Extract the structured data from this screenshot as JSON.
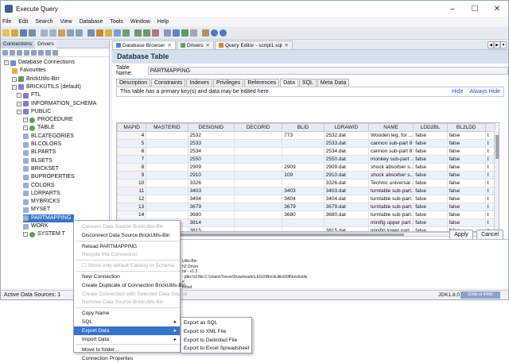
{
  "window": {
    "title": "Execute Query",
    "controls": [
      "–",
      "☐",
      "✕"
    ]
  },
  "menubar": [
    "File",
    "Edit",
    "Search",
    "View",
    "Database",
    "Tools",
    "Window",
    "Help"
  ],
  "left": {
    "tabs": [
      "Connections",
      "Drivers"
    ],
    "tree": [
      {
        "label": "Database Connections",
        "level": 0,
        "icon": "database-icon"
      },
      {
        "label": "Favourites",
        "level": 1,
        "icon": "folder-icon"
      },
      {
        "label": "BrickUtils-Bin",
        "level": 1,
        "icon": "connection-icon"
      },
      {
        "label": "BRICKUTILS (default)",
        "level": 2,
        "icon": "catalog-icon"
      },
      {
        "label": "FTL",
        "level": 3,
        "icon": "schema-icon"
      },
      {
        "label": "INFORMATION_SCHEMA",
        "level": 3,
        "icon": "schema-icon"
      },
      {
        "label": "PUBLIC",
        "level": 3,
        "icon": "schema-icon"
      },
      {
        "label": "PROCEDURE",
        "level": 4,
        "icon": "procedure-icon"
      },
      {
        "label": "TABLE",
        "level": 4,
        "icon": "table-group-icon"
      },
      {
        "label": "BLCATEGORIES",
        "level": 5,
        "icon": "table-icon"
      },
      {
        "label": "BLCOLORS",
        "level": 5,
        "icon": "table-icon"
      },
      {
        "label": "BLPARTS",
        "level": 5,
        "icon": "table-icon"
      },
      {
        "label": "BLSETS",
        "level": 5,
        "icon": "table-icon"
      },
      {
        "label": "BRICKSET",
        "level": 5,
        "icon": "table-icon"
      },
      {
        "label": "BUPROPERTIES",
        "level": 5,
        "icon": "table-icon"
      },
      {
        "label": "COLORS",
        "level": 5,
        "icon": "table-icon"
      },
      {
        "label": "LDRPARTS",
        "level": 5,
        "icon": "table-icon"
      },
      {
        "label": "MYBRICKS",
        "level": 5,
        "icon": "table-icon"
      },
      {
        "label": "MYSET",
        "level": 5,
        "icon": "table-icon"
      },
      {
        "label": "PARTMAPPING",
        "level": 5,
        "icon": "table-icon",
        "selected": true
      },
      {
        "label": "WORK",
        "level": 5,
        "icon": "table-icon"
      },
      {
        "label": "SYSTEM T",
        "level": 4,
        "icon": "system-icon"
      }
    ]
  },
  "right": {
    "tabs": [
      "Database Browser",
      "Drivers",
      "Query Editor - script1.sql"
    ],
    "header": "Database Table",
    "table_name_label": "Table Name:",
    "table_name": "PARTMAPPING",
    "subtabs": [
      "Description",
      "Constraints",
      "Indexes",
      "Privileges",
      "References",
      "Data",
      "SQL",
      "Meta Data"
    ],
    "active_subtab": "Data",
    "info": "This table has a primary key(s) and data may be edited here",
    "links": [
      "Hide",
      "Always Hide"
    ],
    "columns": [
      "MAPID",
      "MASTERID",
      "DESIGNID",
      "DECORID",
      "BLID",
      "LDRAWID",
      "NAME",
      "LDD2BL",
      "BL2LDD",
      ""
    ],
    "rows": [
      [
        "4",
        "",
        "2532",
        "",
        "773",
        "2532.dat",
        "Wooden leg, for ...",
        "false",
        "false",
        "t"
      ],
      [
        "5",
        "",
        "2533",
        "",
        "",
        "2533.dat",
        "cannon sub-part 8...",
        "false",
        "false",
        "t"
      ],
      [
        "6",
        "",
        "2534",
        "",
        "",
        "2534.dat",
        "cannon sub-part 8...",
        "false",
        "false",
        "t"
      ],
      [
        "7",
        "",
        "2550",
        "",
        "",
        "2550.dat",
        "monkey sub-part ...",
        "false",
        "false",
        "t"
      ],
      [
        "8",
        "",
        "2909",
        "",
        "2909",
        "2909.dat",
        "shock absorber s...",
        "false",
        "false",
        "t"
      ],
      [
        "9",
        "",
        "2910",
        "",
        "109",
        "2910.dat",
        "shock absorber s...",
        "false",
        "false",
        "t"
      ],
      [
        "10",
        "",
        "3326",
        "",
        "",
        "3326.dat",
        "Technic universal ...",
        "false",
        "false",
        "t"
      ],
      [
        "11",
        "",
        "3403",
        "",
        "3403",
        "3403.dat",
        "turntable sub-part...",
        "false",
        "false",
        "t"
      ],
      [
        "12",
        "",
        "3404",
        "",
        "3404",
        "3404.dat",
        "turntable sub-part...",
        "false",
        "false",
        "t"
      ],
      [
        "13",
        "",
        "3679",
        "",
        "3679",
        "3679.dat",
        "turntable sub-part...",
        "false",
        "false",
        "t"
      ],
      [
        "14",
        "",
        "3680",
        "",
        "3680",
        "3680.dat",
        "turntable sub-part...",
        "false",
        "false",
        "t"
      ],
      [
        "15",
        "",
        "3814",
        "",
        "",
        "",
        "minifig upper part ...",
        "false",
        "false",
        "t"
      ],
      [
        "16",
        "",
        "3815",
        "",
        "",
        "3815.dat",
        "minifig lower part ...",
        "false",
        "false",
        "t"
      ]
    ],
    "apply": "Apply",
    "cancel": "Cancel",
    "console_lines": [
      "Utils-Bin",
      "h2.Driver",
      "rsl - v1.3",
      ": jdbc:h2:file:C:\\Users\\Trevor\\Downloads\\LEGO\\BrickUtils\\008\\brickutils",
      "e",
      "ected"
    ]
  },
  "status": {
    "left": "Active Data Sources: 1",
    "jdk": "JDK1.8.0",
    "mem": "32Mb of 44Mb"
  },
  "context_menu": [
    {
      "label": "Connect Data Source BrickUtils-Bin",
      "disabled": true
    },
    {
      "label": "Disconnect Data Source BrickUtils-Bin"
    },
    {
      "sep": true
    },
    {
      "label": "Reload PARTMAPPING"
    },
    {
      "label": "Recycle this Connection",
      "disabled": true
    },
    {
      "sep": true
    },
    {
      "label": "☐ Show only default Catalog or Schema",
      "disabled": true
    },
    {
      "sep": true
    },
    {
      "label": "New Connection"
    },
    {
      "label": "Create Duplicate of Connection BrickUtils-Bin"
    },
    {
      "label": "Create Connection with Selected Data Source",
      "disabled": true
    },
    {
      "label": "Remove Data Source BrickUtils-Bin",
      "disabled": true
    },
    {
      "sep": true
    },
    {
      "label": "Copy Name"
    },
    {
      "label": "SQL",
      "submenu": true
    },
    {
      "label": "Export Data",
      "submenu": true,
      "highlighted": true
    },
    {
      "label": "Import Data",
      "submenu": true
    },
    {
      "sep": true
    },
    {
      "label": "Move to folder..."
    },
    {
      "label": "Connection Properties"
    }
  ],
  "submenu": [
    "Export as SQL",
    "Export to XML File",
    "Export to Delimited File",
    "Export to Excel Spreadsheet"
  ],
  "colors": {
    "accent": "#3874c8",
    "header_bg": "#d5dfee",
    "row_alt": "#edf2fa"
  }
}
